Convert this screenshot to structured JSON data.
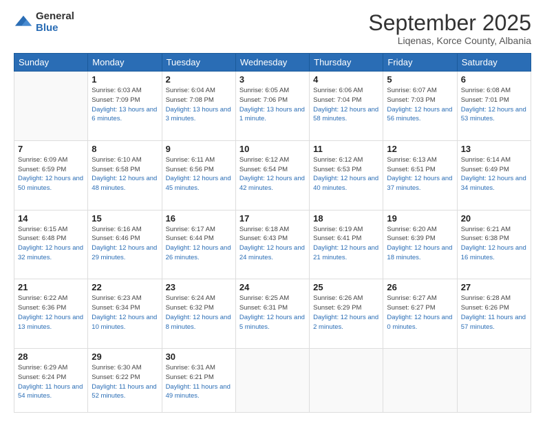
{
  "logo": {
    "general": "General",
    "blue": "Blue"
  },
  "title": "September 2025",
  "subtitle": "Liqenas, Korce County, Albania",
  "days_of_week": [
    "Sunday",
    "Monday",
    "Tuesday",
    "Wednesday",
    "Thursday",
    "Friday",
    "Saturday"
  ],
  "weeks": [
    [
      {
        "day": "",
        "sunrise": "",
        "sunset": "",
        "daylight": ""
      },
      {
        "day": "1",
        "sunrise": "Sunrise: 6:03 AM",
        "sunset": "Sunset: 7:09 PM",
        "daylight": "Daylight: 13 hours and 6 minutes."
      },
      {
        "day": "2",
        "sunrise": "Sunrise: 6:04 AM",
        "sunset": "Sunset: 7:08 PM",
        "daylight": "Daylight: 13 hours and 3 minutes."
      },
      {
        "day": "3",
        "sunrise": "Sunrise: 6:05 AM",
        "sunset": "Sunset: 7:06 PM",
        "daylight": "Daylight: 13 hours and 1 minute."
      },
      {
        "day": "4",
        "sunrise": "Sunrise: 6:06 AM",
        "sunset": "Sunset: 7:04 PM",
        "daylight": "Daylight: 12 hours and 58 minutes."
      },
      {
        "day": "5",
        "sunrise": "Sunrise: 6:07 AM",
        "sunset": "Sunset: 7:03 PM",
        "daylight": "Daylight: 12 hours and 56 minutes."
      },
      {
        "day": "6",
        "sunrise": "Sunrise: 6:08 AM",
        "sunset": "Sunset: 7:01 PM",
        "daylight": "Daylight: 12 hours and 53 minutes."
      }
    ],
    [
      {
        "day": "7",
        "sunrise": "Sunrise: 6:09 AM",
        "sunset": "Sunset: 6:59 PM",
        "daylight": "Daylight: 12 hours and 50 minutes."
      },
      {
        "day": "8",
        "sunrise": "Sunrise: 6:10 AM",
        "sunset": "Sunset: 6:58 PM",
        "daylight": "Daylight: 12 hours and 48 minutes."
      },
      {
        "day": "9",
        "sunrise": "Sunrise: 6:11 AM",
        "sunset": "Sunset: 6:56 PM",
        "daylight": "Daylight: 12 hours and 45 minutes."
      },
      {
        "day": "10",
        "sunrise": "Sunrise: 6:12 AM",
        "sunset": "Sunset: 6:54 PM",
        "daylight": "Daylight: 12 hours and 42 minutes."
      },
      {
        "day": "11",
        "sunrise": "Sunrise: 6:12 AM",
        "sunset": "Sunset: 6:53 PM",
        "daylight": "Daylight: 12 hours and 40 minutes."
      },
      {
        "day": "12",
        "sunrise": "Sunrise: 6:13 AM",
        "sunset": "Sunset: 6:51 PM",
        "daylight": "Daylight: 12 hours and 37 minutes."
      },
      {
        "day": "13",
        "sunrise": "Sunrise: 6:14 AM",
        "sunset": "Sunset: 6:49 PM",
        "daylight": "Daylight: 12 hours and 34 minutes."
      }
    ],
    [
      {
        "day": "14",
        "sunrise": "Sunrise: 6:15 AM",
        "sunset": "Sunset: 6:48 PM",
        "daylight": "Daylight: 12 hours and 32 minutes."
      },
      {
        "day": "15",
        "sunrise": "Sunrise: 6:16 AM",
        "sunset": "Sunset: 6:46 PM",
        "daylight": "Daylight: 12 hours and 29 minutes."
      },
      {
        "day": "16",
        "sunrise": "Sunrise: 6:17 AM",
        "sunset": "Sunset: 6:44 PM",
        "daylight": "Daylight: 12 hours and 26 minutes."
      },
      {
        "day": "17",
        "sunrise": "Sunrise: 6:18 AM",
        "sunset": "Sunset: 6:43 PM",
        "daylight": "Daylight: 12 hours and 24 minutes."
      },
      {
        "day": "18",
        "sunrise": "Sunrise: 6:19 AM",
        "sunset": "Sunset: 6:41 PM",
        "daylight": "Daylight: 12 hours and 21 minutes."
      },
      {
        "day": "19",
        "sunrise": "Sunrise: 6:20 AM",
        "sunset": "Sunset: 6:39 PM",
        "daylight": "Daylight: 12 hours and 18 minutes."
      },
      {
        "day": "20",
        "sunrise": "Sunrise: 6:21 AM",
        "sunset": "Sunset: 6:38 PM",
        "daylight": "Daylight: 12 hours and 16 minutes."
      }
    ],
    [
      {
        "day": "21",
        "sunrise": "Sunrise: 6:22 AM",
        "sunset": "Sunset: 6:36 PM",
        "daylight": "Daylight: 12 hours and 13 minutes."
      },
      {
        "day": "22",
        "sunrise": "Sunrise: 6:23 AM",
        "sunset": "Sunset: 6:34 PM",
        "daylight": "Daylight: 12 hours and 10 minutes."
      },
      {
        "day": "23",
        "sunrise": "Sunrise: 6:24 AM",
        "sunset": "Sunset: 6:32 PM",
        "daylight": "Daylight: 12 hours and 8 minutes."
      },
      {
        "day": "24",
        "sunrise": "Sunrise: 6:25 AM",
        "sunset": "Sunset: 6:31 PM",
        "daylight": "Daylight: 12 hours and 5 minutes."
      },
      {
        "day": "25",
        "sunrise": "Sunrise: 6:26 AM",
        "sunset": "Sunset: 6:29 PM",
        "daylight": "Daylight: 12 hours and 2 minutes."
      },
      {
        "day": "26",
        "sunrise": "Sunrise: 6:27 AM",
        "sunset": "Sunset: 6:27 PM",
        "daylight": "Daylight: 12 hours and 0 minutes."
      },
      {
        "day": "27",
        "sunrise": "Sunrise: 6:28 AM",
        "sunset": "Sunset: 6:26 PM",
        "daylight": "Daylight: 11 hours and 57 minutes."
      }
    ],
    [
      {
        "day": "28",
        "sunrise": "Sunrise: 6:29 AM",
        "sunset": "Sunset: 6:24 PM",
        "daylight": "Daylight: 11 hours and 54 minutes."
      },
      {
        "day": "29",
        "sunrise": "Sunrise: 6:30 AM",
        "sunset": "Sunset: 6:22 PM",
        "daylight": "Daylight: 11 hours and 52 minutes."
      },
      {
        "day": "30",
        "sunrise": "Sunrise: 6:31 AM",
        "sunset": "Sunset: 6:21 PM",
        "daylight": "Daylight: 11 hours and 49 minutes."
      },
      {
        "day": "",
        "sunrise": "",
        "sunset": "",
        "daylight": ""
      },
      {
        "day": "",
        "sunrise": "",
        "sunset": "",
        "daylight": ""
      },
      {
        "day": "",
        "sunrise": "",
        "sunset": "",
        "daylight": ""
      },
      {
        "day": "",
        "sunrise": "",
        "sunset": "",
        "daylight": ""
      }
    ]
  ]
}
